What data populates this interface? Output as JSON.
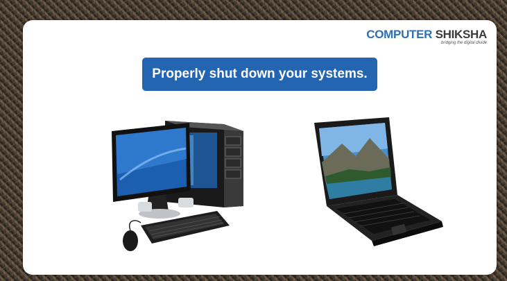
{
  "logo": {
    "brand_part1": "COMPUTER",
    "brand_part2": " SHIKSHA",
    "tagline": "bridging the digital divide"
  },
  "slide": {
    "title": "Properly shut down your systems."
  },
  "illustrations": {
    "desktop": "desktop-computer-icon",
    "laptop": "laptop-icon"
  },
  "colors": {
    "title_bg": "#2465b2",
    "logo_blue": "#2e6fb4",
    "logo_dark": "#3a3a3a",
    "slide_bg": "#ffffff"
  }
}
